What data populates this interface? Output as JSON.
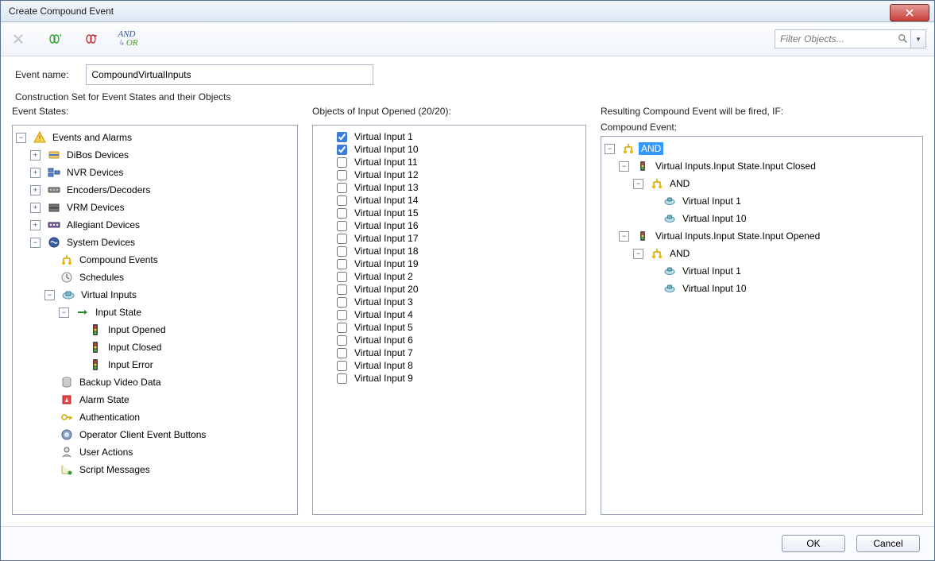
{
  "window": {
    "title": "Create Compound Event"
  },
  "toolbar": {
    "filter_placeholder": "Filter Objects...",
    "and_label": "AND",
    "or_label": "OR"
  },
  "form": {
    "event_name_label": "Event name:",
    "event_name_value": "CompoundVirtualInputs"
  },
  "sections": {
    "construction": "Construction Set for Event States and their Objects",
    "event_states": "Event States:",
    "objects_header": "Objects of Input Opened (20/20):",
    "result_header": "Resulting Compound Event will be fired, IF:",
    "compound_event": "Compound Event:"
  },
  "event_tree": {
    "root": "Events and Alarms",
    "items": [
      {
        "label": "DiBos Devices"
      },
      {
        "label": "NVR Devices"
      },
      {
        "label": "Encoders/Decoders"
      },
      {
        "label": "VRM Devices"
      },
      {
        "label": "Allegiant Devices"
      },
      {
        "label": "System Devices",
        "children": [
          {
            "label": "Compound Events"
          },
          {
            "label": "Schedules"
          },
          {
            "label": "Virtual Inputs",
            "children": [
              {
                "label": "Input State",
                "children": [
                  {
                    "label": "Input Opened"
                  },
                  {
                    "label": "Input Closed"
                  },
                  {
                    "label": "Input Error"
                  }
                ]
              }
            ]
          },
          {
            "label": "Backup Video Data"
          },
          {
            "label": "Alarm State"
          },
          {
            "label": "Authentication"
          },
          {
            "label": "Operator Client Event Buttons"
          },
          {
            "label": "User Actions"
          },
          {
            "label": "Script Messages"
          }
        ]
      }
    ]
  },
  "objects": [
    {
      "label": "Virtual Input 1",
      "checked": true
    },
    {
      "label": "Virtual Input 10",
      "checked": true
    },
    {
      "label": "Virtual Input 11",
      "checked": false
    },
    {
      "label": "Virtual Input 12",
      "checked": false
    },
    {
      "label": "Virtual Input 13",
      "checked": false
    },
    {
      "label": "Virtual Input 14",
      "checked": false
    },
    {
      "label": "Virtual Input 15",
      "checked": false
    },
    {
      "label": "Virtual Input 16",
      "checked": false
    },
    {
      "label": "Virtual Input 17",
      "checked": false
    },
    {
      "label": "Virtual Input 18",
      "checked": false
    },
    {
      "label": "Virtual Input 19",
      "checked": false
    },
    {
      "label": "Virtual Input 2",
      "checked": false
    },
    {
      "label": "Virtual Input 20",
      "checked": false
    },
    {
      "label": "Virtual Input 3",
      "checked": false
    },
    {
      "label": "Virtual Input 4",
      "checked": false
    },
    {
      "label": "Virtual Input 5",
      "checked": false
    },
    {
      "label": "Virtual Input 6",
      "checked": false
    },
    {
      "label": "Virtual Input 7",
      "checked": false
    },
    {
      "label": "Virtual Input 8",
      "checked": false
    },
    {
      "label": "Virtual Input 9",
      "checked": false
    }
  ],
  "compound_tree": {
    "root": "AND",
    "branches": [
      {
        "label": "Virtual Inputs.Input State.Input Closed",
        "op": "AND",
        "leaves": [
          "Virtual Input 1",
          "Virtual Input 10"
        ]
      },
      {
        "label": "Virtual Inputs.Input State.Input Opened",
        "op": "AND",
        "leaves": [
          "Virtual Input 1",
          "Virtual Input 10"
        ]
      }
    ]
  },
  "buttons": {
    "ok": "OK",
    "cancel": "Cancel"
  }
}
